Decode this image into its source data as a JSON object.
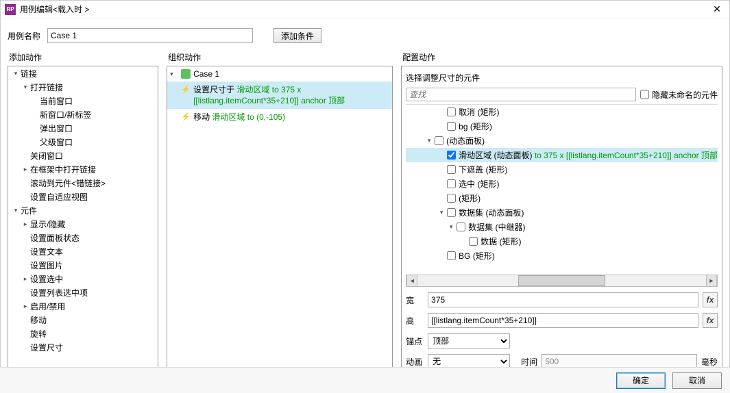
{
  "window": {
    "title": "用例编辑<载入时 >"
  },
  "topform": {
    "label": "用例名称",
    "value": "Case 1",
    "addCondition": "添加条件"
  },
  "columns": {
    "add": "添加动作",
    "org": "组织动作",
    "cfg": "配置动作"
  },
  "addTree": [
    {
      "indent": 0,
      "twist": "down",
      "label": "链接"
    },
    {
      "indent": 1,
      "twist": "down",
      "label": "打开链接"
    },
    {
      "indent": 2,
      "twist": "",
      "label": "当前窗口"
    },
    {
      "indent": 2,
      "twist": "",
      "label": "新窗口/新标签"
    },
    {
      "indent": 2,
      "twist": "",
      "label": "弹出窗口"
    },
    {
      "indent": 2,
      "twist": "",
      "label": "父级窗口"
    },
    {
      "indent": 1,
      "twist": "",
      "label": "关闭窗口"
    },
    {
      "indent": 1,
      "twist": "right",
      "label": "在框架中打开链接"
    },
    {
      "indent": 1,
      "twist": "",
      "label": "滚动到元件<错链接>"
    },
    {
      "indent": 1,
      "twist": "",
      "label": "设置自适应视图"
    },
    {
      "indent": 0,
      "twist": "down",
      "label": "元件"
    },
    {
      "indent": 1,
      "twist": "right",
      "label": "显示/隐藏"
    },
    {
      "indent": 1,
      "twist": "",
      "label": "设置面板状态"
    },
    {
      "indent": 1,
      "twist": "",
      "label": "设置文本"
    },
    {
      "indent": 1,
      "twist": "",
      "label": "设置图片"
    },
    {
      "indent": 1,
      "twist": "right",
      "label": "设置选中"
    },
    {
      "indent": 1,
      "twist": "",
      "label": "设置列表选中项"
    },
    {
      "indent": 1,
      "twist": "right",
      "label": "启用/禁用"
    },
    {
      "indent": 1,
      "twist": "",
      "label": "移动"
    },
    {
      "indent": 1,
      "twist": "",
      "label": "旋转"
    },
    {
      "indent": 1,
      "twist": "",
      "label": "设置尺寸"
    }
  ],
  "org": {
    "case": "Case 1",
    "lines": [
      {
        "selected": true,
        "pre": "设置尺寸于 ",
        "green": "滑动区域 to 375 x [[listlang.itemCount*35+210]] anchor 顶部"
      },
      {
        "selected": false,
        "pre": "移动 ",
        "green": "滑动区域 to (0,-105)"
      }
    ]
  },
  "cfg": {
    "sectionTitle": "选择调整尺寸的元件",
    "searchPlaceholder": "查找",
    "hideUnnamed": "隐藏未命名的元件",
    "tree": [
      {
        "cls": "ci0",
        "tw": "",
        "checked": false,
        "label": "取消 (矩形)",
        "green": ""
      },
      {
        "cls": "ci0",
        "tw": "",
        "checked": false,
        "label": "bg (矩形)",
        "green": ""
      },
      {
        "cls": "ci1",
        "tw": "down",
        "checked": false,
        "label": "(动态面板)",
        "green": ""
      },
      {
        "cls": "ci2",
        "tw": "",
        "checked": true,
        "selected": true,
        "label": "滑动区域 (动态面板) ",
        "green": "to 375 x [[listlang.itemCount*35+210]] anchor 顶部"
      },
      {
        "cls": "ci2",
        "tw": "",
        "checked": false,
        "label": "下遮盖 (矩形)",
        "green": ""
      },
      {
        "cls": "ci2",
        "tw": "",
        "checked": false,
        "label": "选中 (矩形)",
        "green": ""
      },
      {
        "cls": "ci2",
        "tw": "",
        "checked": false,
        "label": "(矩形)",
        "green": ""
      },
      {
        "cls": "ci3",
        "tw": "down",
        "checked": false,
        "label": "数据集 (动态面板)",
        "green": ""
      },
      {
        "cls": "ci4",
        "tw": "down",
        "checked": false,
        "label": "数据集 (中继器)",
        "green": ""
      },
      {
        "cls": "ci5",
        "tw": "",
        "checked": false,
        "label": "数据 (矩形)",
        "green": ""
      },
      {
        "cls": "ci2",
        "tw": "",
        "checked": false,
        "label": "BG (矩形)",
        "green": ""
      }
    ],
    "form": {
      "widthLabel": "宽",
      "widthValue": "375",
      "heightLabel": "高",
      "heightValue": "[[listlang.itemCount*35+210]]",
      "anchorLabel": "锚点",
      "anchorValue": "顶部",
      "animLabel": "动画",
      "animValue": "无",
      "timeLabel": "时间",
      "timeValue": "500",
      "timeUnit": "毫秒",
      "fx": "fx"
    }
  },
  "footer": {
    "ok": "确定",
    "cancel": "取消"
  }
}
